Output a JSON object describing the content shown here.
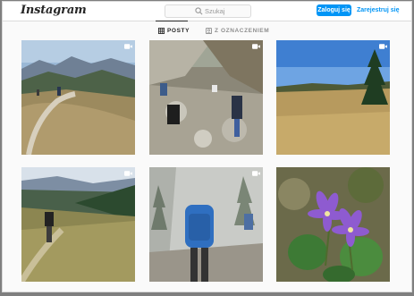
{
  "header": {
    "logo_text": "Instagram",
    "search": {
      "placeholder": "Szukaj",
      "icon": "search-icon"
    },
    "login_label": "Zaloguj się",
    "signup_label": "Zarejestruj się"
  },
  "tabs": [
    {
      "label": "POSTY",
      "icon": "grid-icon",
      "active": true
    },
    {
      "label": "Z OZNACZENIEM",
      "icon": "tag-icon",
      "active": false
    }
  ],
  "posts": [
    {
      "description": "mountain ridge trail with hikers",
      "badge": "video-icon"
    },
    {
      "description": "hikers climbing rocky slope",
      "badge": "video-icon"
    },
    {
      "description": "autumn meadow with spruce",
      "badge": "video-icon"
    },
    {
      "description": "hiker walking down grassy path",
      "badge": "video-icon"
    },
    {
      "description": "hiker in blue jacket in fog",
      "badge": "video-icon"
    },
    {
      "description": "purple alpine flowers",
      "badge": "video-icon"
    }
  ],
  "colors": {
    "accent": "#0095f6",
    "text": "#262626",
    "muted": "#8e8e8e",
    "border": "#dbdbdb"
  }
}
